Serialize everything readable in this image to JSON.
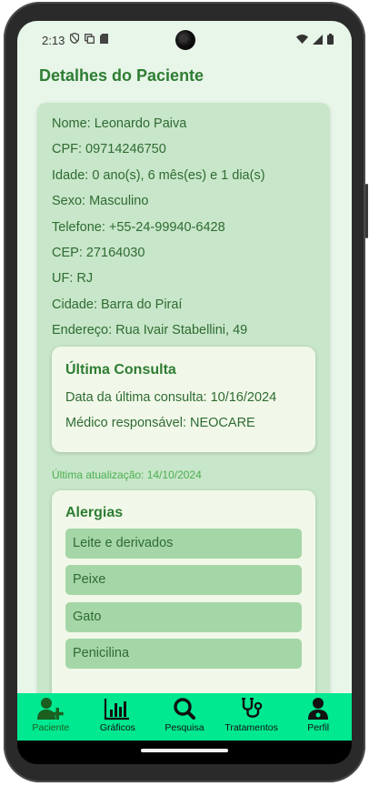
{
  "status_bar": {
    "time": "2:13"
  },
  "page": {
    "title": "Detalhes do Paciente"
  },
  "patient": {
    "name": "Nome: Leonardo Paiva",
    "cpf": "CPF: 09714246750",
    "age": "Idade: 0 ano(s), 6 mês(es) e 1 dia(s)",
    "sex": "Sexo: Masculino",
    "phone": "Telefone: +55-24-99940-6428",
    "cep": "CEP: 27164030",
    "uf": "UF: RJ",
    "city": "Cidade: Barra do Piraí",
    "address": "Endereço: Rua Ivair Stabellini, 49"
  },
  "last_consult": {
    "heading": "Última Consulta",
    "date": "Data da última consulta: 10/16/2024",
    "doctor": "Médico responsável: NEOCARE"
  },
  "updated": "Última atualização: 14/10/2024",
  "allergies": {
    "heading": "Alergias",
    "items": [
      "Leite e derivados",
      "Peixe",
      "Gato",
      "Penicilina"
    ]
  },
  "nav": {
    "items": [
      {
        "label": "Paciente",
        "icon": "user-plus-icon",
        "active": true
      },
      {
        "label": "Gráficos",
        "icon": "bar-chart-icon"
      },
      {
        "label": "Pesquisa",
        "icon": "search-icon"
      },
      {
        "label": "Tratamentos",
        "icon": "stethoscope-icon"
      },
      {
        "label": "Perfil",
        "icon": "doctor-icon"
      }
    ]
  },
  "colors": {
    "background": "#e8f5e9",
    "card": "#c8e6c9",
    "inner_card": "#f1f8e9",
    "allergy_item": "#a5d6a7",
    "title": "#2e7d32",
    "nav_bar": "#00e890"
  }
}
